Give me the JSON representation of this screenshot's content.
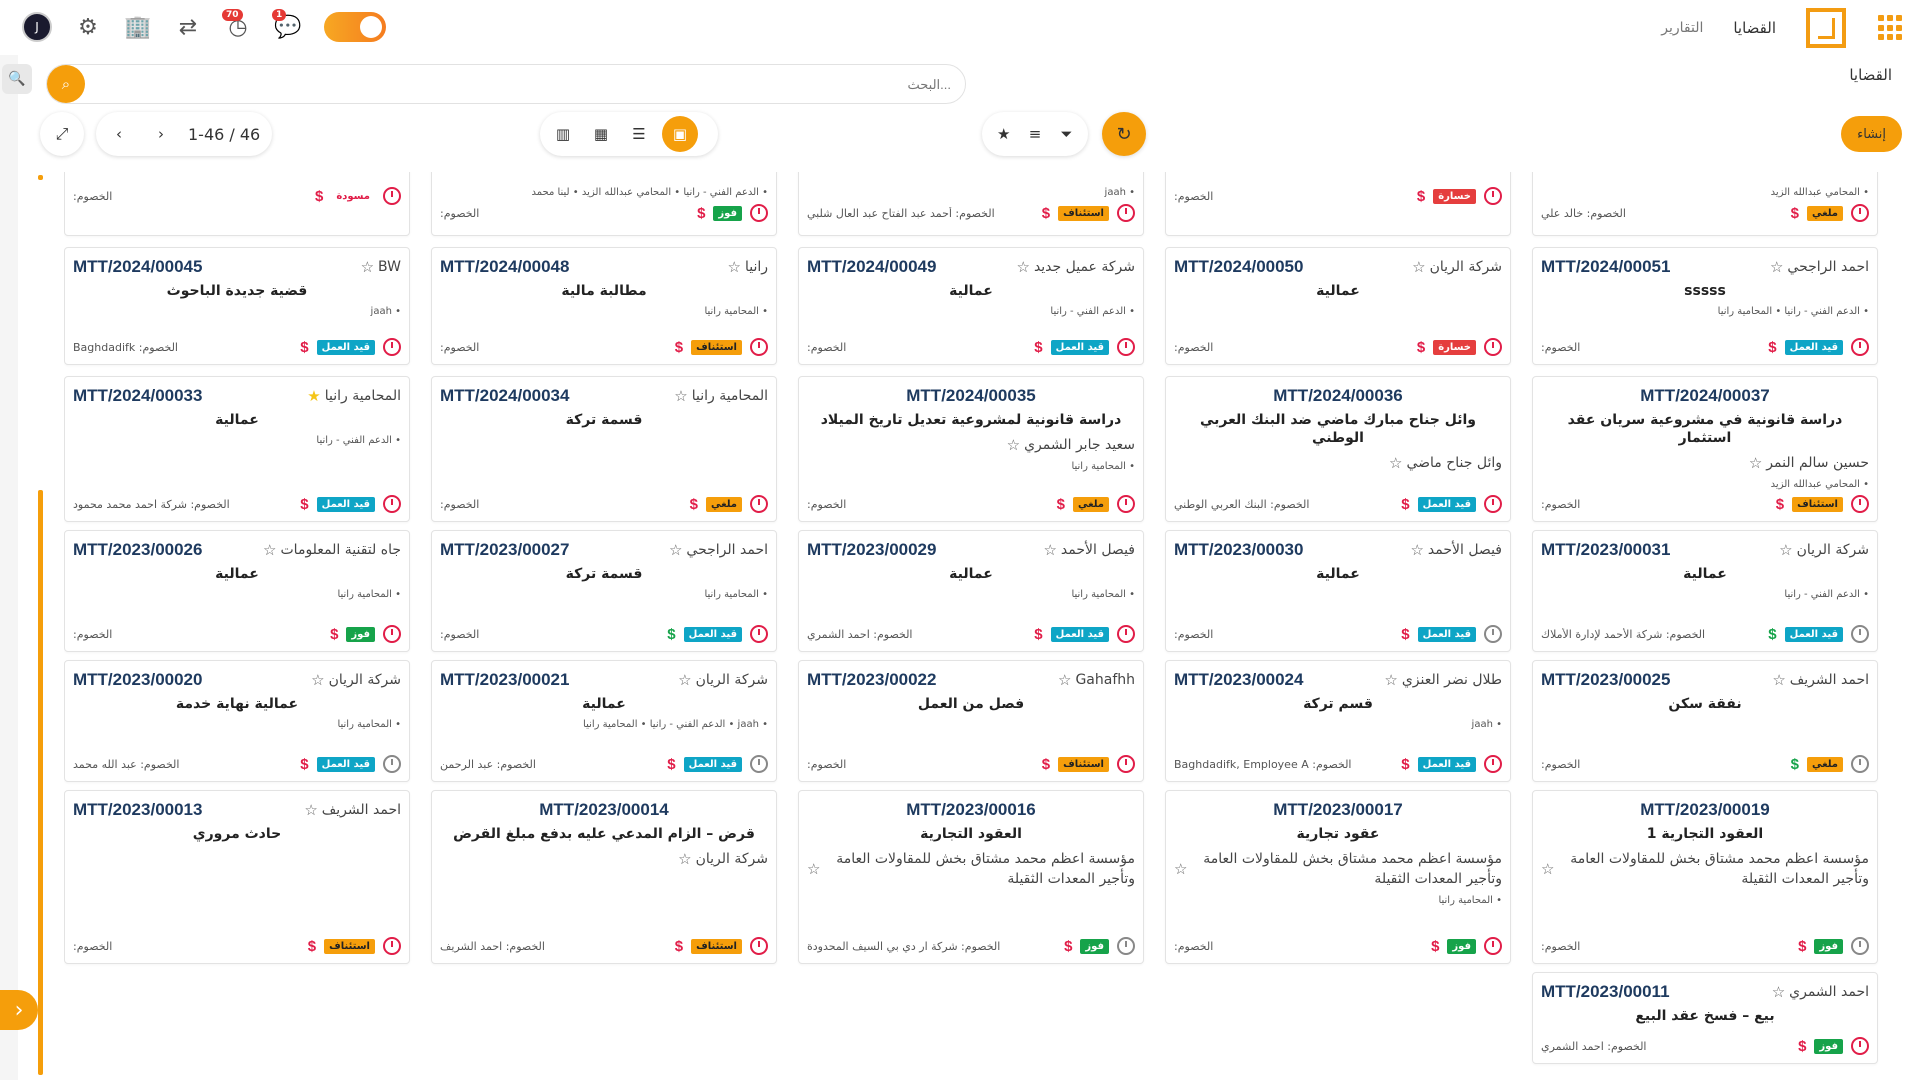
{
  "topbar": {
    "avatar_letter": "J",
    "activities_count": "70",
    "messages_count": "1",
    "nav_cases": "القضايا",
    "nav_reports": "التقارير"
  },
  "search": {
    "placeholder": "البحث..."
  },
  "breadcrumb": "القضايا",
  "pager": {
    "text": "1-46 / 46"
  },
  "create_label": "إنشاء",
  "colors": {
    "accent": "#f59e0b",
    "case_number": "#1e3a5f",
    "tag_blue": "#0ea5c6",
    "tag_red": "#e53e3e",
    "tag_green": "#16a34a"
  },
  "opponent_prefix": "الخصوم:",
  "top_partial": [
    {
      "opp": "الخصوم:",
      "tag": "مسودة",
      "tag_type": "plain",
      "dollar": "$"
    },
    {
      "opp": "الخصوم:",
      "team": "الدعم الفني - رانيا • المحامي عبدالله الزيد • لينا محمد",
      "tag": "فوز",
      "tag_type": "green",
      "dollar": "$"
    },
    {
      "opp": "الخصوم: أحمد عبد الفتاح عبد العال شلبي",
      "team": "jaah",
      "tag": "استئناف",
      "tag_type": "orange",
      "dollar": "$"
    },
    {
      "opp": "الخصوم:",
      "tag": "خسارة",
      "tag_type": "red",
      "dollar": "$"
    },
    {
      "opp": "الخصوم: خالد علي",
      "team": "المحامي عبدالله الزيد",
      "tag": "ملغي",
      "tag_type": "orange",
      "dollar": "$"
    }
  ],
  "row1": [
    {
      "num": "MTT/2024/00045",
      "client": "BW",
      "subject": "قضية جديدة الباحوث",
      "team": "jaah",
      "opp": "الخصوم: Baghdadifk",
      "tag": "قيد العمل",
      "tag_type": "blue"
    },
    {
      "num": "MTT/2024/00048",
      "client": "رانيا",
      "subject": "مطالبة مالية",
      "team": "المحامية رانيا",
      "opp": "الخصوم:",
      "tag": "استئناف",
      "tag_type": "orange"
    },
    {
      "num": "MTT/2024/00049",
      "client": "شركة عميل جديد",
      "subject": "عمالية",
      "team": "الدعم الفني - رانيا",
      "opp": "الخصوم:",
      "tag": "قيد العمل",
      "tag_type": "blue"
    },
    {
      "num": "MTT/2024/00050",
      "client": "شركة الريان",
      "subject": "عمالية",
      "team": "",
      "opp": "الخصوم:",
      "tag": "خسارة",
      "tag_type": "red"
    },
    {
      "num": "MTT/2024/00051",
      "client": "احمد الراجحي",
      "subject": "sssss",
      "team": "الدعم الفني - رانيا • المحامية رانيا",
      "opp": "الخصوم:",
      "tag": "قيد العمل",
      "tag_type": "blue"
    }
  ],
  "row2": [
    {
      "num": "MTT/2024/00033",
      "client": "المحامية رانيا",
      "star": "filled",
      "subject": "عمالية",
      "team": "الدعم الفني - رانيا",
      "opp": "الخصوم: شركة احمد محمد محمود",
      "tag": "قيد العمل",
      "tag_type": "blue"
    },
    {
      "num": "MTT/2024/00034",
      "client": "المحامية رانيا",
      "subject": "قسمة تركة",
      "team": "",
      "opp": "الخصوم:",
      "tag": "ملغي",
      "tag_type": "orange"
    },
    {
      "num": "MTT/2024/00035",
      "client": "سعيد جابر الشمري",
      "subject": "دراسة قانونية لمشروعية تعديل تاريخ الميلاد",
      "team": "المحامية رانيا",
      "opp": "الخصوم:",
      "tag": "ملغي",
      "tag_type": "orange"
    },
    {
      "num": "MTT/2024/00036",
      "client": "وائل جناح ماضي",
      "subject": "وائل جناح مبارك ماضي ضد البنك العربي الوطني",
      "team": "",
      "opp": "الخصوم: البنك العربي الوطني",
      "tag": "قيد العمل",
      "tag_type": "blue"
    },
    {
      "num": "MTT/2024/00037",
      "client": "حسين سالم النمر",
      "subject": "دراسة قانونية في مشروعية سريان عقد استثمار",
      "team": "المحامي عبدالله الزيد",
      "opp": "الخصوم:",
      "tag": "استئناف",
      "tag_type": "orange"
    }
  ],
  "row3": [
    {
      "num": "MTT/2023/00026",
      "client": "جاه لتقنية المعلومات",
      "subject": "عمالية",
      "team": "المحامية رانيا",
      "opp": "الخصوم:",
      "tag": "فوز",
      "tag_type": "green"
    },
    {
      "num": "MTT/2023/00027",
      "client": "احمد الراجحي",
      "subject": "قسمة تركة",
      "team": "المحامية رانيا",
      "opp": "الخصوم:",
      "tag": "قيد العمل",
      "tag_type": "blue",
      "dollar_green": true
    },
    {
      "num": "MTT/2023/00029",
      "client": "فيصل الأحمد",
      "subject": "عمالية",
      "team": "المحامية رانيا",
      "opp": "الخصوم: احمد الشمري",
      "tag": "قيد العمل",
      "tag_type": "blue"
    },
    {
      "num": "MTT/2023/00030",
      "client": "فيصل الأحمد",
      "subject": "عمالية",
      "team": "",
      "opp": "الخصوم:",
      "tag": "قيد العمل",
      "tag_type": "blue",
      "clock_gray": true
    },
    {
      "num": "MTT/2023/00031",
      "client": "شركة الريان",
      "subject": "عمالية",
      "team": "الدعم الفني - رانيا",
      "opp": "الخصوم: شركة الأحمد لإدارة الأملاك",
      "tag": "قيد العمل",
      "tag_type": "blue",
      "dollar_green": true,
      "clock_gray": true
    }
  ],
  "row4": [
    {
      "num": "MTT/2023/00020",
      "client": "شركة الريان",
      "subject": "عمالية نهاية خدمة",
      "team": "المحامية رانيا",
      "opp": "الخصوم: عبد الله محمد",
      "tag": "قيد العمل",
      "tag_type": "blue",
      "clock_gray": true
    },
    {
      "num": "MTT/2023/00021",
      "client": "شركة الريان",
      "subject": "عمالية",
      "team": "jaah • الدعم الفني - رانيا • المحامية رانيا",
      "opp": "الخصوم: عبد الرحمن",
      "tag": "قيد العمل",
      "tag_type": "blue",
      "clock_gray": true
    },
    {
      "num": "MTT/2023/00022",
      "client": "Gahafhh",
      "subject": "فصل من العمل",
      "team": "",
      "opp": "الخصوم:",
      "tag": "استئناف",
      "tag_type": "orange"
    },
    {
      "num": "MTT/2023/00024",
      "client": "طلال نضر العنزي",
      "subject": "قسم تركة",
      "team": "jaah",
      "opp": "الخصوم: Baghdadifk, Employee A",
      "tag": "قيد العمل",
      "tag_type": "blue"
    },
    {
      "num": "MTT/2023/00025",
      "client": "احمد الشريف",
      "subject": "نفقة سكن",
      "team": "",
      "opp": "الخصوم:",
      "tag": "ملغي",
      "tag_type": "orange",
      "dollar_green": true,
      "clock_gray": true
    }
  ],
  "row5": [
    {
      "num": "MTT/2023/00013",
      "client": "احمد الشريف",
      "subject": "حادث مروري",
      "team": "",
      "opp": "الخصوم:",
      "tag": "استئناف",
      "tag_type": "orange"
    },
    {
      "num": "MTT/2023/00014",
      "client": "شركة الريان",
      "subject": "قرض – الزام المدعي عليه بدفع مبلغ القرض",
      "team": "",
      "opp": "الخصوم: احمد الشريف",
      "tag": "استئناف",
      "tag_type": "orange"
    },
    {
      "num": "MTT/2023/00016",
      "client": "مؤسسة اعظم محمد مشتاق بخش للمقاولات العامة وتأجير المعدات الثقيلة",
      "subject": "العقود التجارية",
      "team": "",
      "opp": "الخصوم: شركة ار دي بي السيف المحدودة",
      "tag": "فوز",
      "tag_type": "green",
      "clock_gray": true
    },
    {
      "num": "MTT/2023/00017",
      "client": "مؤسسة اعظم محمد مشتاق بخش للمقاولات العامة وتأجير المعدات الثقيلة",
      "subject": "عقود تجارية",
      "team": "المحامية رانيا",
      "opp": "الخصوم:",
      "tag": "فوز",
      "tag_type": "green"
    },
    {
      "num": "MTT/2023/00019",
      "client": "مؤسسة اعظم محمد مشتاق بخش للمقاولات العامة وتأجير المعدات الثقيلة",
      "subject": "العقود التجارية 1",
      "team": "",
      "opp": "الخصوم:",
      "tag": "فوز",
      "tag_type": "green",
      "clock_gray": true
    }
  ],
  "row6": [
    {
      "num": "MTT/2023/00011",
      "client": "احمد الشمري",
      "subject": "بيع – فسخ عقد البيع",
      "team": "",
      "opp": "الخصوم: احمد الشمري",
      "tag": "فوز",
      "tag_type": "green"
    }
  ]
}
